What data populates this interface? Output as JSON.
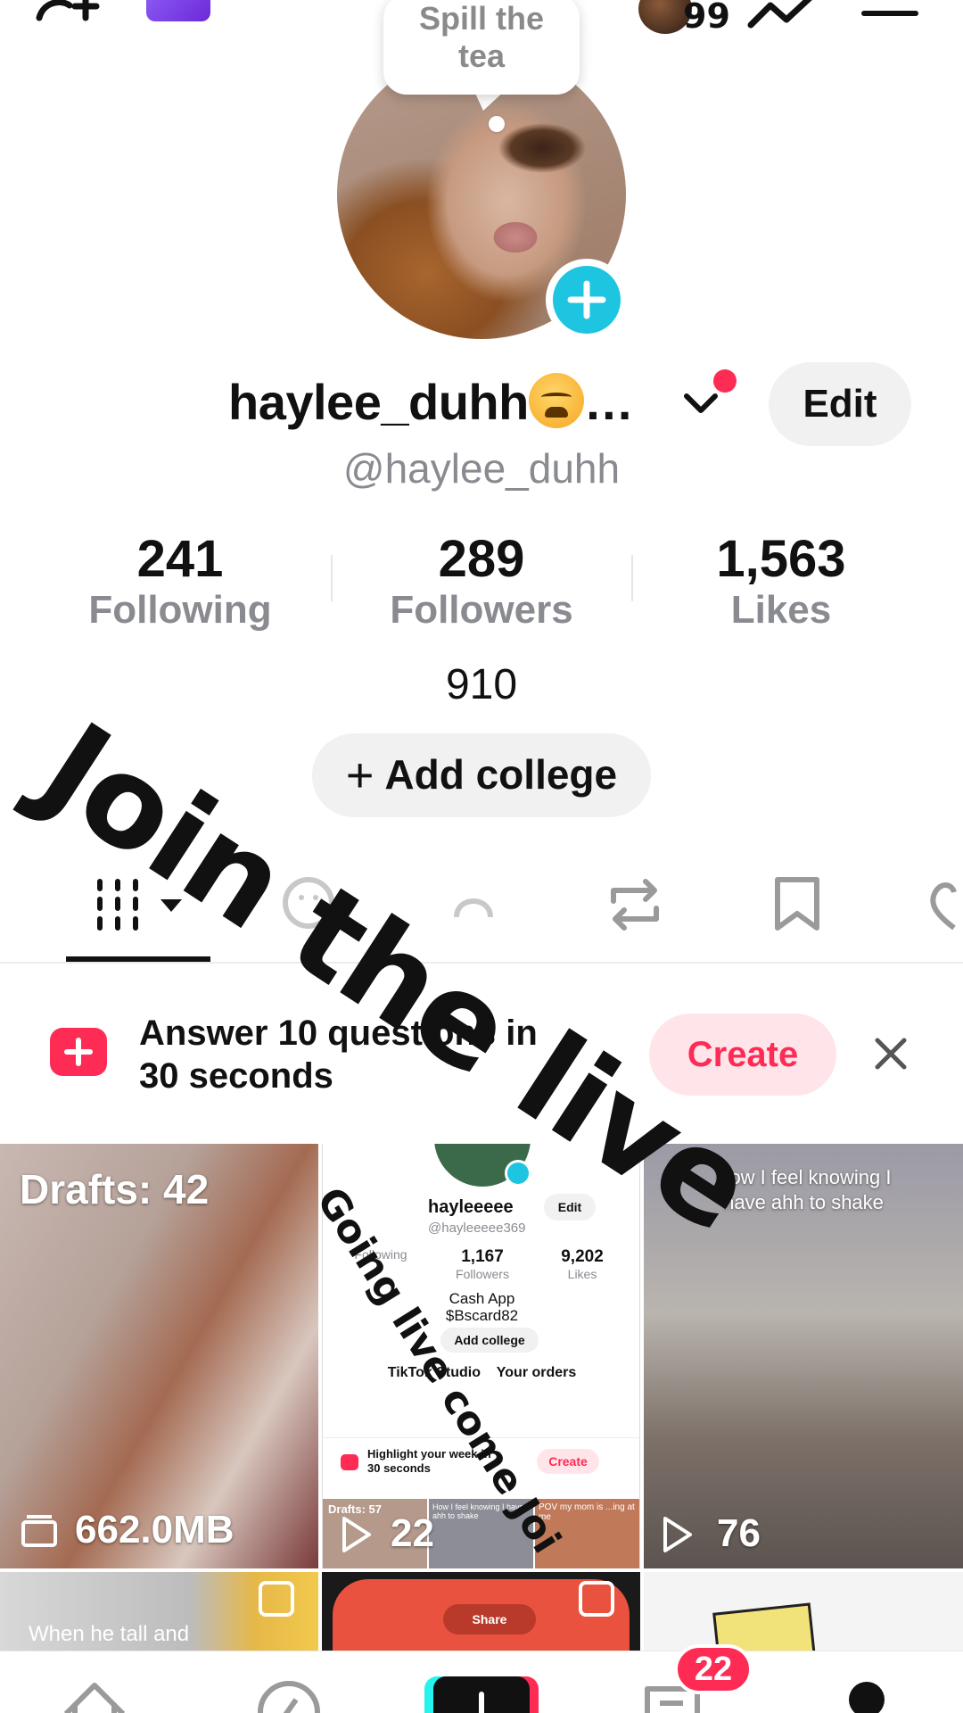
{
  "top_bar": {
    "notification_count": "99"
  },
  "profile": {
    "speech_bubble_line1": "Spill the",
    "speech_bubble_line2": "tea",
    "display_name": "haylee_duhh",
    "display_name_ellipsis": "…",
    "edit_label": "Edit",
    "handle": "@haylee_duhh",
    "stats": [
      {
        "value": "241",
        "label": "Following"
      },
      {
        "value": "289",
        "label": "Followers"
      },
      {
        "value": "1,563",
        "label": "Likes"
      }
    ],
    "bio": "910",
    "add_college_label": "Add college"
  },
  "tabs": [
    "videos-grid",
    "reposts-face",
    "private-lock",
    "repost-arrows",
    "saved-bookmark",
    "liked-heart"
  ],
  "banner": {
    "text_line1": "Answer 10 questions in",
    "text_line2": "30 seconds",
    "create_label": "Create"
  },
  "grid": {
    "drafts_label": "Drafts: 42",
    "drafts_size": "662.0MB",
    "video2_views": "22",
    "video3_caption_line1": "How I feel knowing I",
    "video3_caption_line2": "have ahh to shake",
    "video3_views": "76",
    "video4_caption": "When he tall and",
    "mini_profile": {
      "name": "hayleeeee",
      "edit_label": "Edit",
      "handle": "@hayleeeee369",
      "stats": [
        {
          "value": "",
          "label": "Following"
        },
        {
          "value": "1,167",
          "label": "Followers"
        },
        {
          "value": "9,202",
          "label": "Likes"
        }
      ],
      "bio_line1": "Cash App",
      "bio_line2": "$Bscard82",
      "add_college_label": "Add college",
      "studio_label": "TikTok Studio",
      "orders_label": "Your orders",
      "banner_line1": "Highlight your week in",
      "banner_line2": "30 seconds",
      "create_label": "Create",
      "drafts_label": "Drafts: 57",
      "thumb2_caption": "How I feel knowing I have ahh to shake",
      "thumb3_caption": "POV my mom is ...ing at me"
    },
    "video5_share_label": "Share"
  },
  "overlay_text": {
    "main": "Join the live",
    "secondary": "Going live come Joi"
  },
  "bottom_nav": {
    "inbox_badge": "22",
    "items": [
      "home-icon",
      "discover-icon",
      "create-icon",
      "inbox-icon",
      "profile-icon"
    ]
  },
  "colors": {
    "accent_red": "#fe2c55",
    "accent_cyan": "#25f4ee",
    "avatar_plus_blue": "#1ec5e0",
    "muted_text": "#8a8b91"
  }
}
